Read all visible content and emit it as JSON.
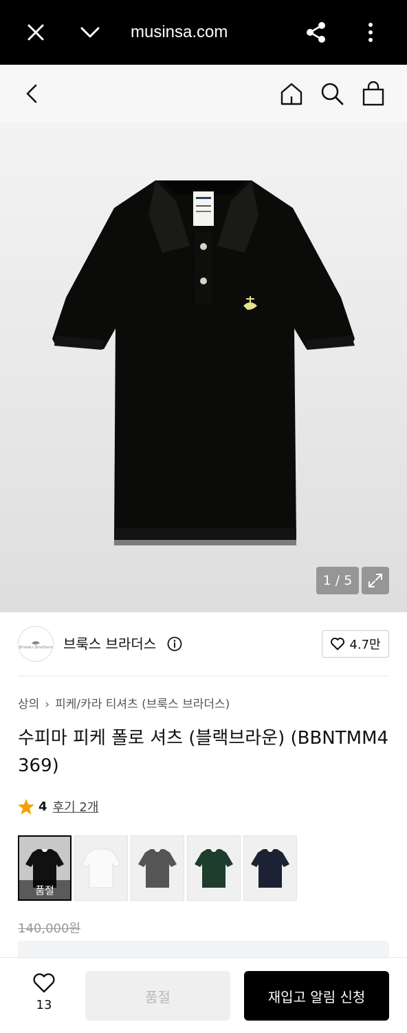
{
  "browser": {
    "url": "musinsa.com",
    "icons": [
      "close-icon",
      "chevron-down-icon",
      "share-icon",
      "more-vertical-icon"
    ]
  },
  "header": {
    "icons": [
      "back-arrow-icon",
      "home-icon",
      "search-icon",
      "shopping-bag-icon"
    ]
  },
  "gallery": {
    "pager": "1 / 5",
    "current": 1,
    "total": 5
  },
  "brand": {
    "name": "브룩스 브라더스",
    "logo_text": "Brooks Brothers",
    "likes": "4.7만"
  },
  "product": {
    "breadcrumb": [
      "상의",
      "피케/카라 티셔츠 (브룩스 브라더스)"
    ],
    "title": "수피마 피케 폴로 셔츠 (블랙브라운) (BBNTMM4369)",
    "rating": "4",
    "reviews": "후기 2개",
    "price_original": "140,000원"
  },
  "swatches": [
    {
      "color": "#111111",
      "selected": true,
      "label": "품절"
    },
    {
      "color": "#f6f6f6",
      "selected": false,
      "label": ""
    },
    {
      "color": "#555555",
      "selected": false,
      "label": ""
    },
    {
      "color": "#1f3d2c",
      "selected": false,
      "label": ""
    },
    {
      "color": "#1c2233",
      "selected": false,
      "label": ""
    }
  ],
  "bottom": {
    "wish_count": "13",
    "soldout_label": "품절",
    "restock_label": "재입고 알림 신청"
  },
  "colors": {
    "star": "#f5a000",
    "shirt": "#0b0b0a",
    "logo": "#e6e28a"
  }
}
